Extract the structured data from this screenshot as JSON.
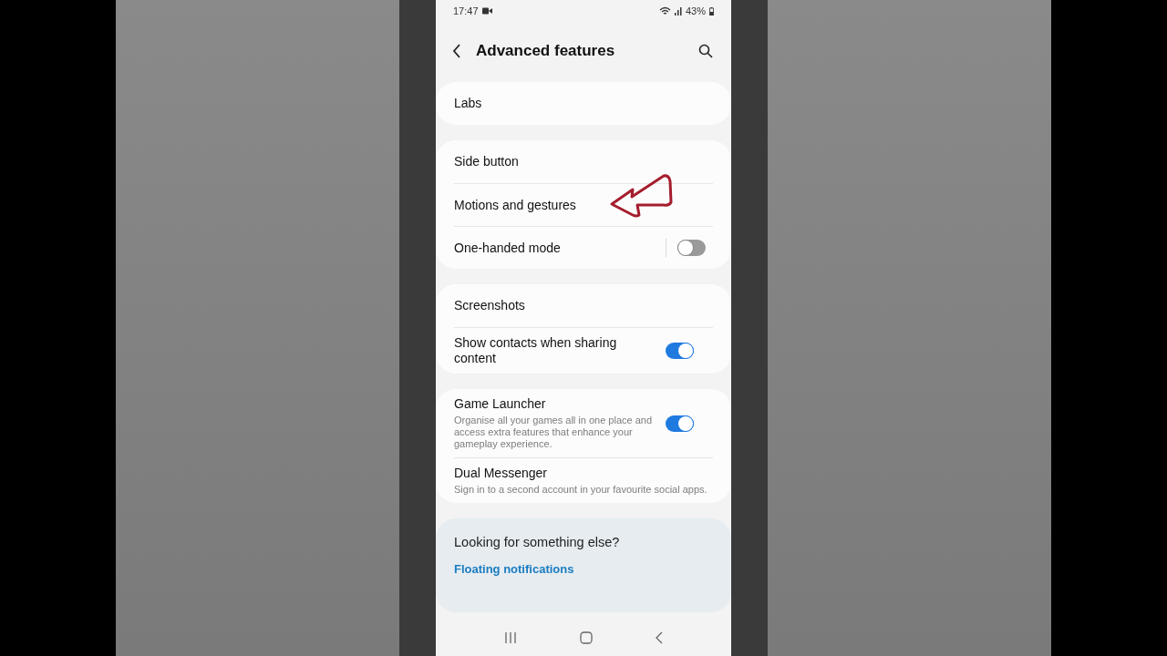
{
  "status_bar": {
    "time": "17:47",
    "battery": "43%"
  },
  "header": {
    "title": "Advanced features"
  },
  "groups": [
    {
      "items": [
        {
          "kind": "link",
          "title": "Labs"
        }
      ]
    },
    {
      "items": [
        {
          "kind": "link",
          "title": "Side button"
        },
        {
          "kind": "link",
          "title": "Motions and gestures",
          "annotated": true
        },
        {
          "kind": "toggle",
          "title": "One-handed mode",
          "on": false,
          "separator": true
        }
      ]
    },
    {
      "items": [
        {
          "kind": "link",
          "title": "Screenshots"
        },
        {
          "kind": "toggle",
          "title": "Show contacts when sharing content",
          "on": true,
          "separator": false
        }
      ]
    },
    {
      "items": [
        {
          "kind": "toggle",
          "title": "Game Launcher",
          "subtitle": "Organise all your games all in one place and access extra features that enhance your gameplay experience.",
          "on": true,
          "separator": false
        },
        {
          "kind": "link",
          "title": "Dual Messenger",
          "subtitle": "Sign in to a second account in your favourite social apps."
        }
      ]
    }
  ],
  "suggestions": {
    "title": "Looking for something else?",
    "links": [
      "Floating notifications"
    ]
  }
}
